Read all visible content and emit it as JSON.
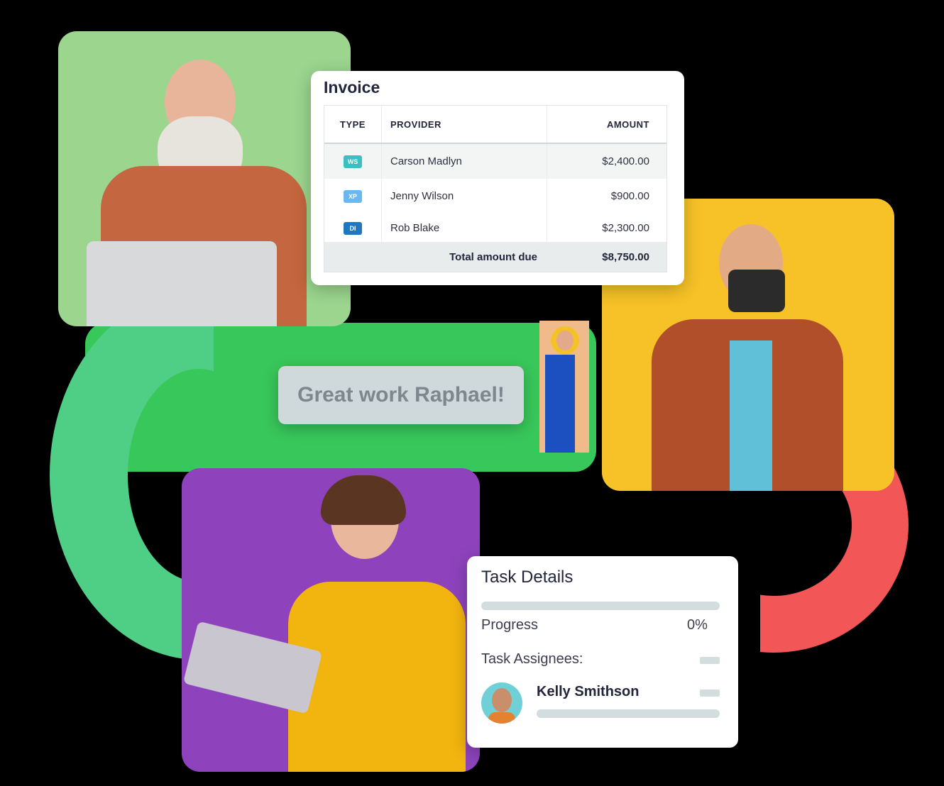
{
  "invoice": {
    "title": "Invoice",
    "headers": {
      "type": "TYPE",
      "provider": "PROVIDER",
      "amount": "AMOUNT"
    },
    "rows": [
      {
        "type": "WS",
        "provider": "Carson Madlyn",
        "amount": "$2,400.00"
      },
      {
        "type": "XP",
        "provider": "Jenny Wilson",
        "amount": "$900.00"
      },
      {
        "type": "DI",
        "provider": "Rob Blake",
        "amount": "$2,300.00"
      }
    ],
    "total_label": "Total amount due",
    "total_value": "$8,750.00"
  },
  "chat": {
    "message": "Great work Raphael!"
  },
  "task": {
    "title": "Task Details",
    "progress_label": "Progress",
    "progress_value": "0%",
    "assignees_label": "Task Assignees:",
    "assignee_name": "Kelly Smithson"
  },
  "colors": {
    "green_ring": "#4fcf86",
    "red_ring": "#f25656",
    "yellow_card": "#f6c227",
    "purple_card": "#8e43bd",
    "badge_ws": "#3bbfc2",
    "badge_xp": "#6bb7ef",
    "badge_di": "#1f77c2"
  }
}
